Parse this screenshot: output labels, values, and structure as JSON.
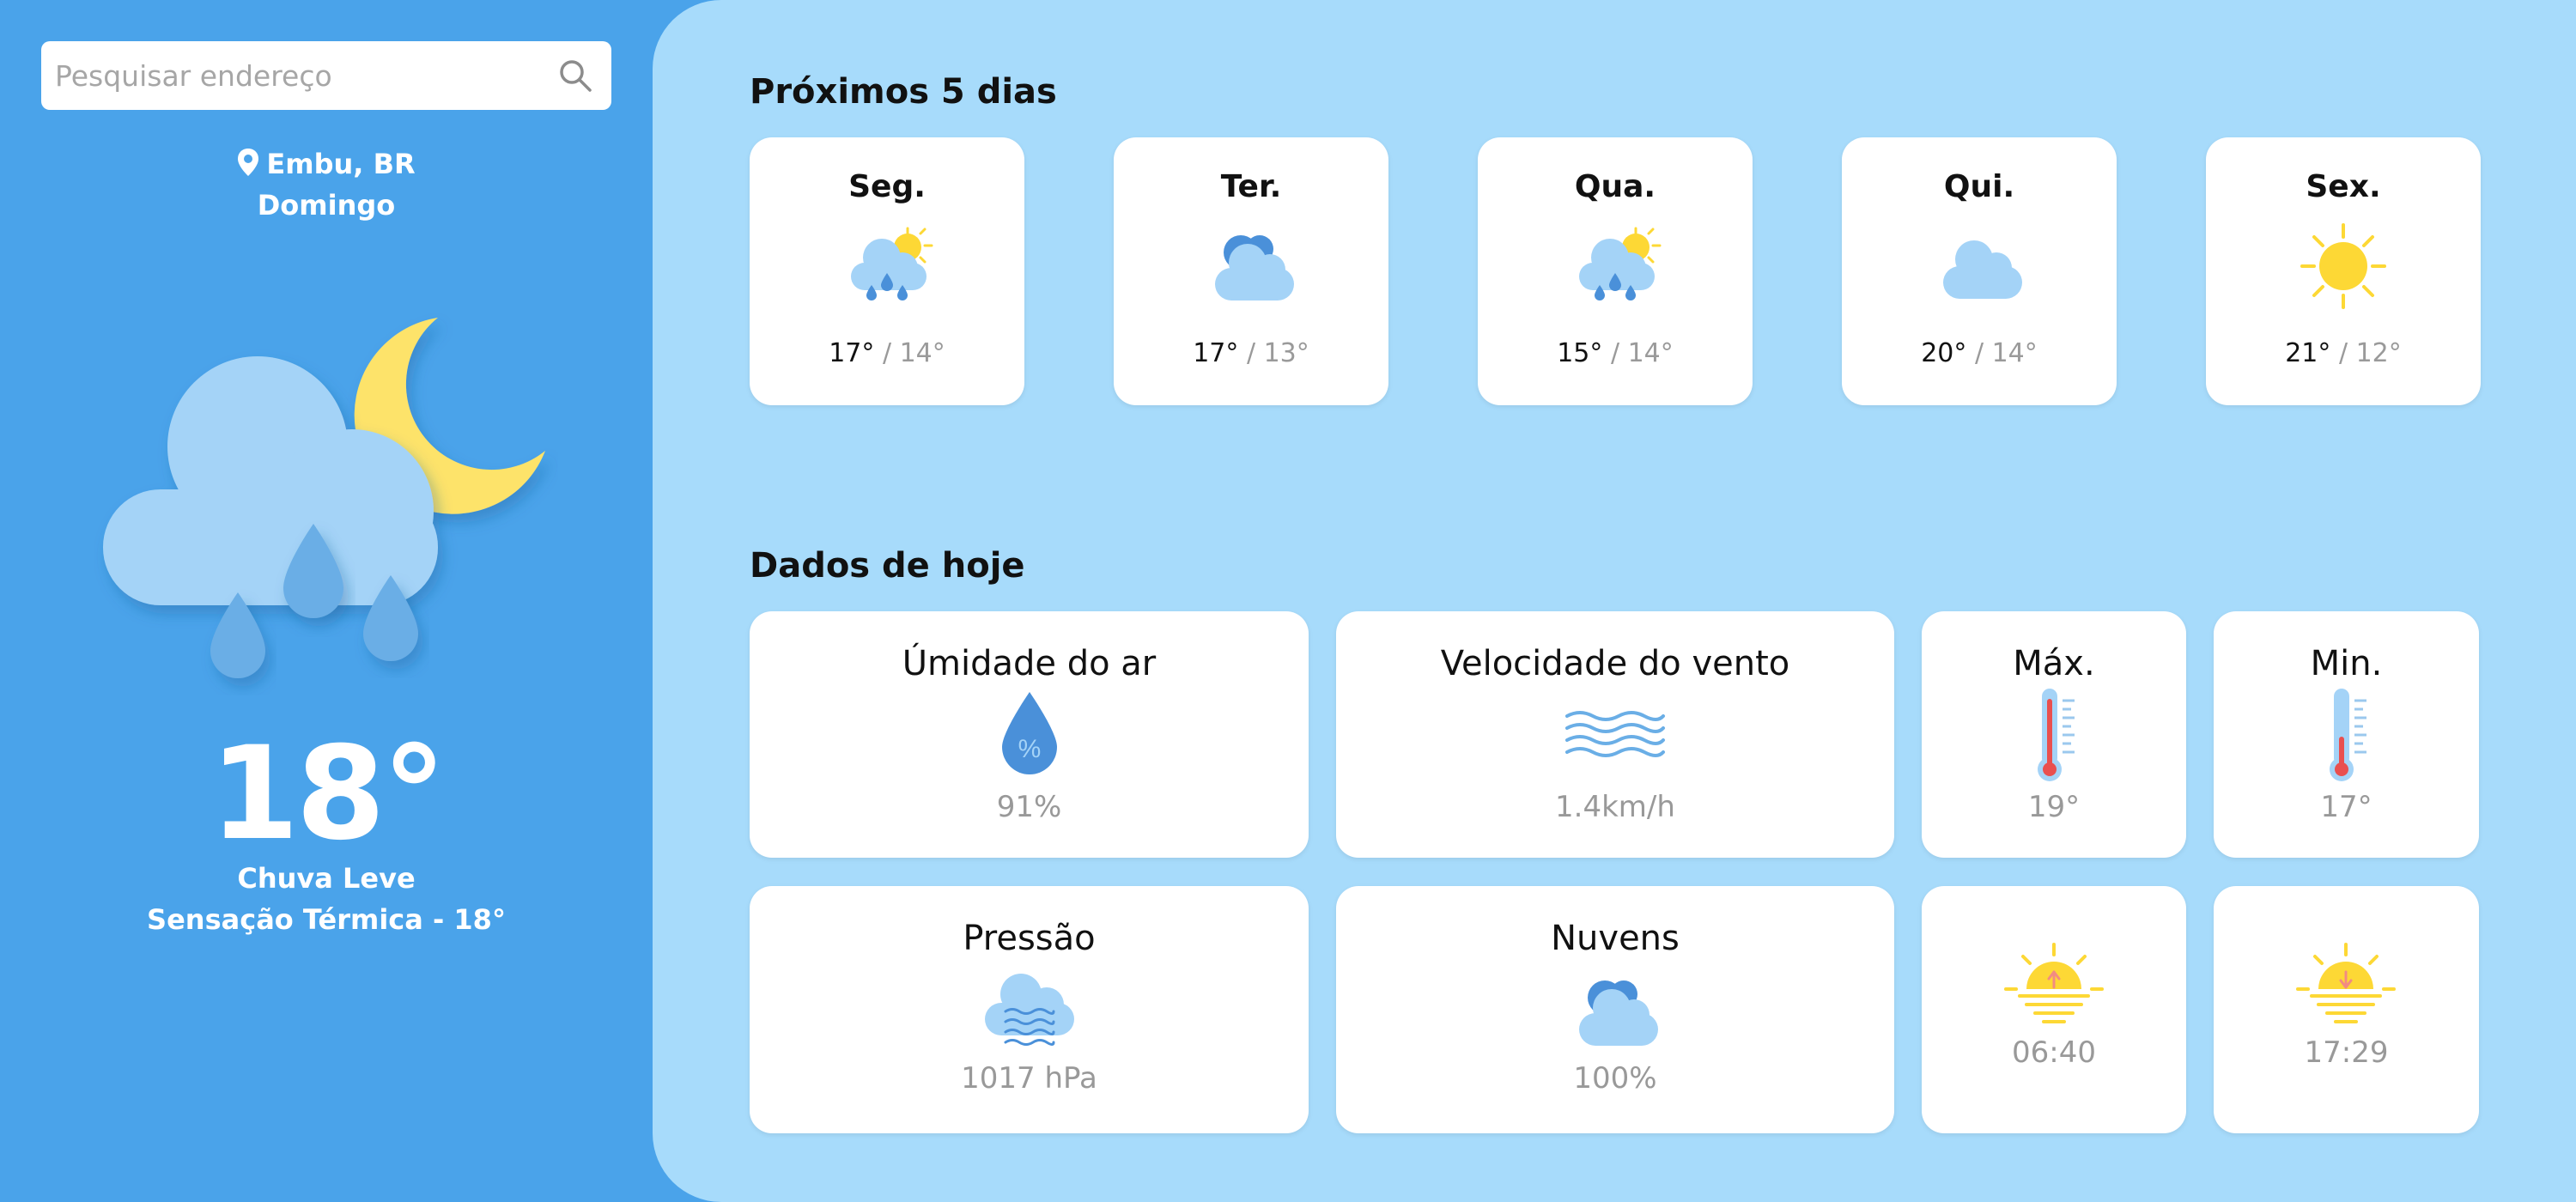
{
  "search": {
    "placeholder": "Pesquisar endereço"
  },
  "location": {
    "city": "Embu, BR",
    "day": "Domingo"
  },
  "current": {
    "temperature": "18°",
    "condition": "Chuva Leve",
    "feels_like": "Sensação Térmica - 18°",
    "icon": "night-cloud-rain-icon"
  },
  "forecast": {
    "title": "Próximos 5 dias",
    "days": [
      {
        "day": "Seg.",
        "max": "17°",
        "min": "14°",
        "icon": "sun-cloud-rain-icon"
      },
      {
        "day": "Ter.",
        "max": "17°",
        "min": "13°",
        "icon": "clouds-icon"
      },
      {
        "day": "Qua.",
        "max": "15°",
        "min": "14°",
        "icon": "sun-cloud-rain-icon"
      },
      {
        "day": "Qui.",
        "max": "20°",
        "min": "14°",
        "icon": "cloud-icon"
      },
      {
        "day": "Sex.",
        "max": "21°",
        "min": "12°",
        "icon": "sun-icon"
      }
    ],
    "separator": "/"
  },
  "today": {
    "title": "Dados de hoje",
    "humidity": {
      "label": "Úmidade do ar",
      "value": "91%",
      "icon": "humidity-drop-icon"
    },
    "wind": {
      "label": "Velocidade do vento",
      "value": "1.4km/h",
      "icon": "wind-icon"
    },
    "max": {
      "label": "Máx.",
      "value": "19°",
      "icon": "thermometer-high-icon"
    },
    "min": {
      "label": "Min.",
      "value": "17°",
      "icon": "thermometer-low-icon"
    },
    "pressure": {
      "label": "Pressão",
      "value": "1017 hPa",
      "icon": "pressure-cloud-icon"
    },
    "clouds": {
      "label": "Nuvens",
      "value": "100%",
      "icon": "clouds-icon"
    },
    "sunrise": {
      "value": "06:40",
      "icon": "sunrise-icon"
    },
    "sunset": {
      "value": "17:29",
      "icon": "sunset-icon"
    }
  },
  "colors": {
    "sidebar_bg": "#4aa3ea",
    "main_bg": "#a7dbfb",
    "card_bg": "#ffffff",
    "sun": "#fdd835",
    "cloud_light": "#a4d3f7",
    "cloud_dark": "#6aaee6"
  }
}
